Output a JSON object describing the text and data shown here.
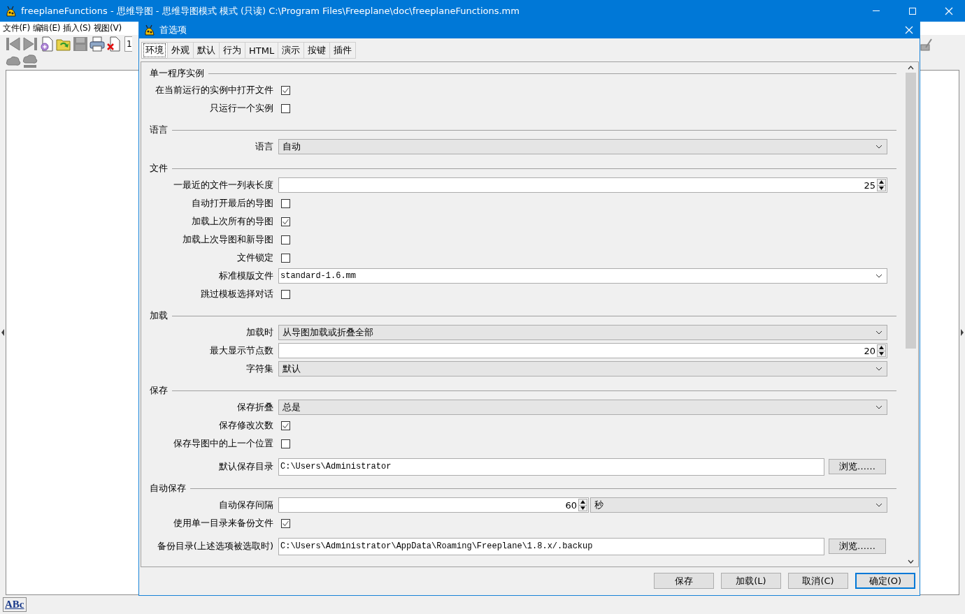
{
  "main_window": {
    "title": "freeplaneFunctions - 思维导图 - 思维导图模式 模式 (只读) C:\\Program Files\\Freeplane\\doc\\freeplaneFunctions.mm",
    "menu": [
      "文件(F)",
      "编辑(E)",
      "插入(S)",
      "视图(V)"
    ],
    "toolbar_field": "1",
    "status_bar": {
      "spellcheck": "ABc"
    }
  },
  "dialog": {
    "title": "首选项",
    "tabs": [
      {
        "label": "环境",
        "selected": true
      },
      {
        "label": "外观",
        "selected": false
      },
      {
        "label": "默认",
        "selected": false
      },
      {
        "label": "行为",
        "selected": false
      },
      {
        "label": "HTML",
        "selected": false
      },
      {
        "label": "演示",
        "selected": false
      },
      {
        "label": "按键",
        "selected": false
      },
      {
        "label": "插件",
        "selected": false
      }
    ],
    "sections": [
      {
        "title": "单一程序实例",
        "rows": [
          {
            "kind": "checkbox",
            "label": "在当前运行的实例中打开文件",
            "checked": true
          },
          {
            "kind": "checkbox",
            "label": "只运行一个实例",
            "checked": false
          }
        ]
      },
      {
        "title": "语言",
        "rows": [
          {
            "kind": "combo",
            "label": "语言",
            "value": "自动"
          }
        ]
      },
      {
        "title": "文件",
        "rows": [
          {
            "kind": "spinner",
            "label": "一最近的文件一列表长度",
            "value": "25"
          },
          {
            "kind": "checkbox",
            "label": "自动打开最后的导图",
            "checked": false
          },
          {
            "kind": "checkbox",
            "label": "加载上次所有的导图",
            "checked": true
          },
          {
            "kind": "checkbox",
            "label": "加载上次导图和新导图",
            "checked": false
          },
          {
            "kind": "checkbox",
            "label": "文件锁定",
            "checked": false
          },
          {
            "kind": "editable_combo",
            "label": "标准模版文件",
            "value": "standard-1.6.mm"
          },
          {
            "kind": "checkbox",
            "label": "跳过模板选择对话",
            "checked": false
          }
        ]
      },
      {
        "title": "加载",
        "rows": [
          {
            "kind": "combo",
            "label": "加载时",
            "value": "从导图加载或折叠全部"
          },
          {
            "kind": "spinner",
            "label": "最大显示节点数",
            "value": "20"
          },
          {
            "kind": "combo",
            "label": "字符集",
            "value": "默认"
          }
        ]
      },
      {
        "title": "保存",
        "rows": [
          {
            "kind": "combo",
            "label": "保存折叠",
            "value": "总是"
          },
          {
            "kind": "checkbox",
            "label": "保存修改次数",
            "checked": true
          },
          {
            "kind": "checkbox",
            "label": "保存导图中的上一个位置",
            "checked": false
          },
          {
            "kind": "directory",
            "label": "默认保存目录",
            "value": "C:\\Users\\Administrator",
            "button": "浏览……"
          }
        ]
      },
      {
        "title": "自动保存",
        "rows": [
          {
            "kind": "spinner_unit",
            "label": "自动保存间隔",
            "value": "60",
            "unit": "秒"
          },
          {
            "kind": "checkbox",
            "label": "使用单一目录来备份文件",
            "checked": true
          },
          {
            "kind": "directory",
            "label": "备份目录(上述选项被选取时)",
            "value": "C:\\Users\\Administrator\\AppData\\Roaming\\Freeplane\\1.8.x/.backup",
            "button": "浏览……"
          }
        ]
      }
    ],
    "buttons": [
      {
        "label": "保存",
        "focused": false
      },
      {
        "label": "加载(L)",
        "focused": false
      },
      {
        "label": "取消(C)",
        "focused": false
      },
      {
        "label": "确定(O)",
        "focused": true
      }
    ]
  }
}
